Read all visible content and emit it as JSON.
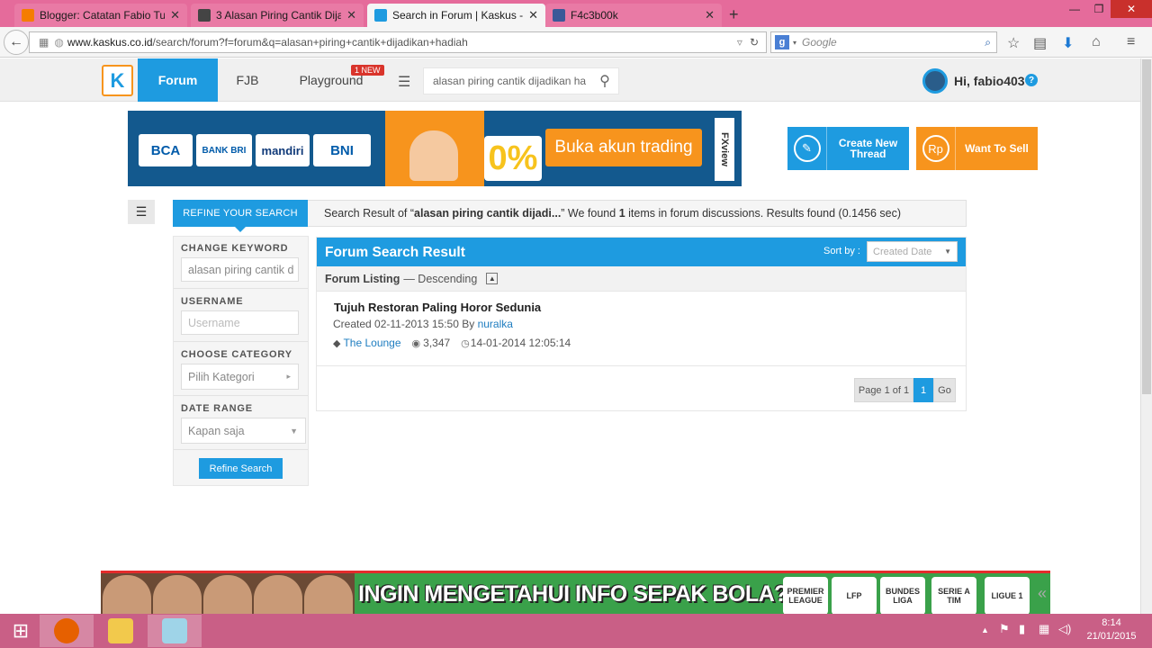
{
  "browser": {
    "tabs": [
      {
        "title": "Blogger: Catatan Fabio Tu...",
        "favicon_color": "#f57d00"
      },
      {
        "title": "3 Alasan Piring Cantik Dija...",
        "favicon_color": "#444444"
      },
      {
        "title": "Search in Forum | Kaskus - ...",
        "favicon_color": "#1e9be0"
      },
      {
        "title": "F4c3b00k",
        "favicon_color": "#3b5998"
      }
    ],
    "url_host": "www.kaskus.co.id",
    "url_path": "/search/forum?f=forum&q=alasan+piring+cantik+dijadikan+hadiah",
    "search_placeholder": "Google"
  },
  "header": {
    "nav": [
      "Forum",
      "FJB",
      "Playground"
    ],
    "new_badge": "1 NEW",
    "search_query": "alasan piring cantik dijadikan ha",
    "greeting": "Hi, fabio403",
    "help": "?"
  },
  "banner": {
    "banks": [
      "BCA",
      "BANK BRI",
      "mandiri",
      "BNI"
    ],
    "percent": "0%",
    "cta": "Buka akun trading",
    "brand": "FXview"
  },
  "actions": {
    "create_thread": "Create New Thread",
    "sell": "Want To Sell",
    "sell_icon": "Rp"
  },
  "refine": {
    "tab_label": "REFINE YOUR SEARCH",
    "result_prefix": "Search Result of “",
    "result_query": "alasan piring cantik dijadi...",
    "result_mid": "” We found ",
    "result_count": "1",
    "result_suffix": " items in forum discussions. Results found (0.1456 sec)"
  },
  "sidebar": {
    "keyword_label": "CHANGE KEYWORD",
    "keyword_value": "alasan piring cantik d",
    "username_label": "USERNAME",
    "username_placeholder": "Username",
    "category_label": "CHOOSE CATEGORY",
    "category_value": "Pilih Kategori",
    "date_label": "DATE RANGE",
    "date_value": "Kapan saja",
    "button": "Refine Search"
  },
  "results": {
    "title": "Forum Search Result",
    "sort_label": "Sort by :",
    "sort_value": "Created Date",
    "listing_label": "Forum Listing",
    "listing_order": "— Descending",
    "thread": {
      "title": "Tujuh Restoran Paling Horor Sedunia",
      "created_prefix": "Created 02-11-2013 15:50 By ",
      "author": "nuralka",
      "category": "The Lounge",
      "views": "3,347",
      "last_post": "14-01-2014 12:05:14"
    },
    "pager": {
      "info": "Page 1 of 1",
      "current": "1",
      "go": "Go"
    }
  },
  "bottom_ad": {
    "text": "INGIN MENGETAHUI INFO SEPAK BOLA???",
    "leagues": [
      "PREMIER LEAGUE",
      "LFP",
      "BUNDES LIGA",
      "SERIE A TIM",
      "LIGUE 1"
    ]
  },
  "taskbar": {
    "time": "8:14",
    "date": "21/01/2015"
  }
}
